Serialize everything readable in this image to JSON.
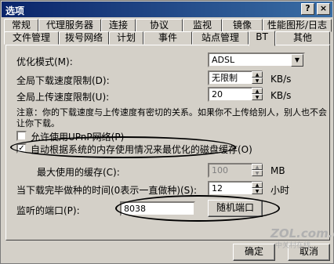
{
  "window": {
    "title": "选项",
    "help_glyph": "?",
    "close_glyph": "×"
  },
  "tabs": {
    "row1": [
      "常规",
      "代理服务器",
      "连接",
      "协议",
      "监视",
      "镜像",
      "性能图形/日志"
    ],
    "row2": [
      "文件管理",
      "拨号网络",
      "计划",
      "事件",
      "站点管理",
      "BT",
      "其他"
    ],
    "active": "BT"
  },
  "bt": {
    "optimize_mode_label": "优化模式(M):",
    "optimize_mode_value": "ADSL",
    "download_limit_label": "全局下载速度限制(D):",
    "download_limit_value": "无限制",
    "download_unit": "KB/s",
    "upload_limit_label": "全局上传速度限制(U):",
    "upload_limit_value": "20",
    "upload_unit": "KB/s",
    "note_line1": "注意：你的下载速度与上传速度有密切的关系。如果你不上传给别人，别人也不会",
    "note_line2": "让你下载。",
    "upnp_label": "允许使用UPnP网络(P)",
    "upnp_checked": false,
    "auto_cache_label": "自动根据系统的内存使用情况来最优化的磁盘缓存(O)",
    "auto_cache_checked": true,
    "max_cache_label": "最大使用的缓存(C):",
    "max_cache_value": "100",
    "max_cache_unit": "MB",
    "seed_time_label": "当下载完毕做种的时间(0表示一直做种)(S):",
    "seed_time_value": "12",
    "seed_time_unit": "小时",
    "port_label": "监听的端口(P):",
    "port_value": "8038",
    "random_port_label": "随机端口"
  },
  "footer": {
    "ok": "确定",
    "cancel": "取消"
  },
  "watermark": {
    "logo": "ZOL.com.cn",
    "sub": "中关村在线"
  }
}
